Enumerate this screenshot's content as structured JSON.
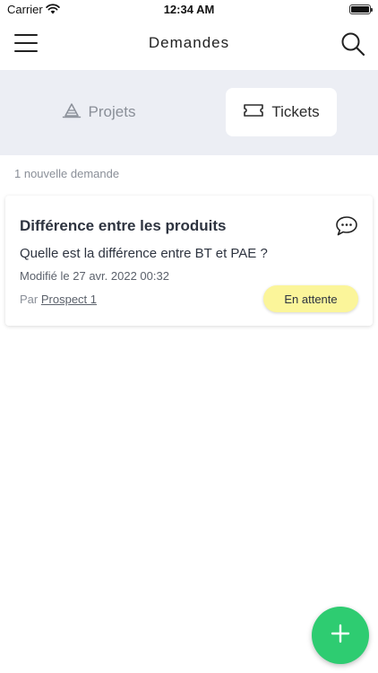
{
  "status_bar": {
    "carrier": "Carrier",
    "time": "12:34 AM",
    "battery_level": 1.0
  },
  "header": {
    "title": "Demandes",
    "menu_icon": "hamburger-menu-icon",
    "search_icon": "search-icon"
  },
  "segments": [
    {
      "label": "Projets",
      "icon": "traffic-cone-icon",
      "selected": false
    },
    {
      "label": "Tickets",
      "icon": "ticket-icon",
      "selected": true
    }
  ],
  "list": {
    "count_text": "1 nouvelle demande",
    "items": [
      {
        "title": "Différence entre les produits",
        "question": "Quelle est la différence entre BT et PAE ?",
        "modified": "Modifié le 27 avr. 2022 00:32",
        "author_prefix": "Par",
        "author": "Prospect 1",
        "status": "En attente",
        "icon": "chat-bubble-icon"
      }
    ]
  },
  "fab": {
    "icon": "plus-icon"
  },
  "colors": {
    "accent": "#2ecc71",
    "status_pending": "#fbf59a",
    "segment_bg": "#eceef4"
  }
}
